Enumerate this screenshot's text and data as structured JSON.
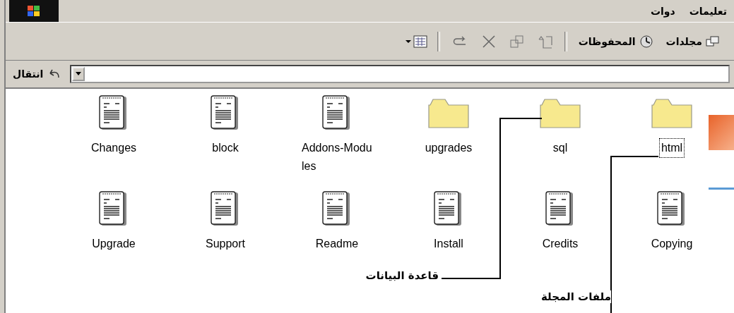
{
  "menu": [
    {
      "label": "تعليمات"
    },
    {
      "label": "دوات"
    }
  ],
  "toolbar": {
    "folders": "مجلدات",
    "history": "المحفوظات"
  },
  "address": {
    "go": "انتقال"
  },
  "items": [
    {
      "name": "html",
      "kind": "folder",
      "selected": true
    },
    {
      "name": "sql",
      "kind": "folder",
      "selected": false
    },
    {
      "name": "upgrades",
      "kind": "folder",
      "selected": false
    },
    {
      "name": "Addons-Modules",
      "kind": "file",
      "selected": false
    },
    {
      "name": "block",
      "kind": "file",
      "selected": false
    },
    {
      "name": "Changes",
      "kind": "file",
      "selected": false
    },
    {
      "name": "Copying",
      "kind": "file",
      "selected": false
    },
    {
      "name": "Credits",
      "kind": "file",
      "selected": false
    },
    {
      "name": "Install",
      "kind": "file",
      "selected": false
    },
    {
      "name": "Readme",
      "kind": "file",
      "selected": false
    },
    {
      "name": "Support",
      "kind": "file",
      "selected": false
    },
    {
      "name": "Upgrade",
      "kind": "file",
      "selected": false
    }
  ],
  "annotations": [
    {
      "label": "قاعدة البيانات"
    },
    {
      "label": "ملفات المجلة"
    }
  ]
}
